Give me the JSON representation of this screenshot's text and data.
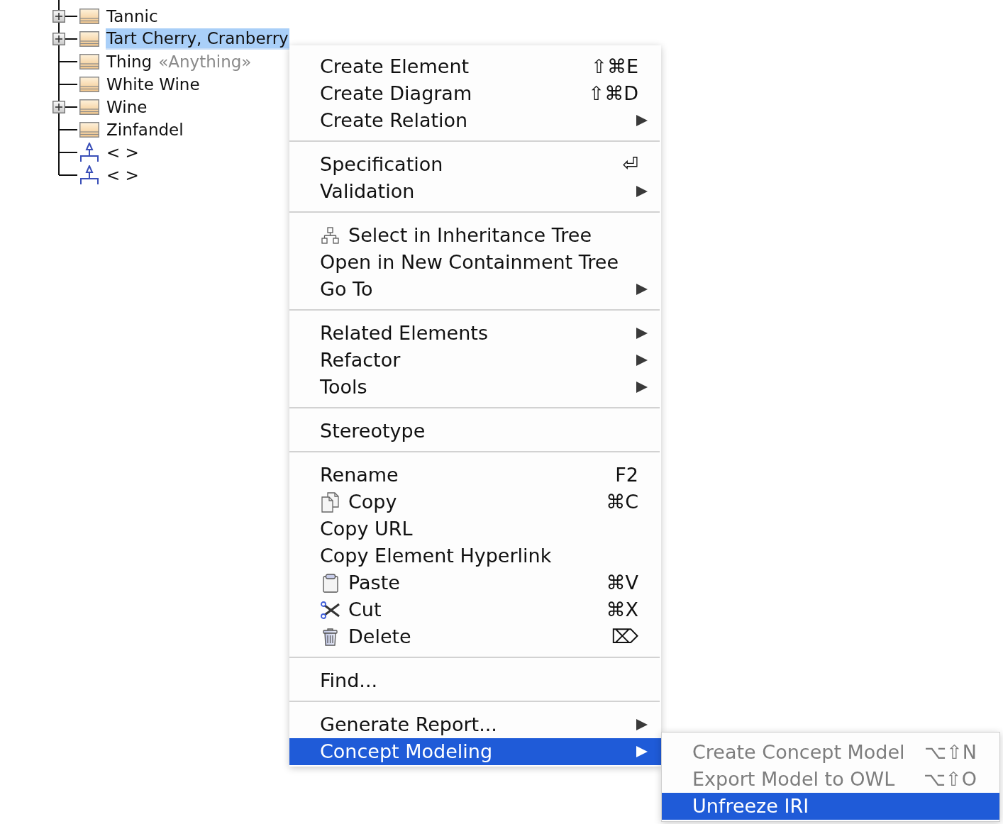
{
  "tree": {
    "items": [
      {
        "label": "Tannic",
        "kind": "class",
        "expandable": true,
        "selected": false
      },
      {
        "label": "Tart Cherry, Cranberry",
        "kind": "class",
        "expandable": true,
        "selected": true
      },
      {
        "label": "Thing",
        "stereotype": "«Anything»",
        "kind": "class",
        "expandable": false,
        "selected": false
      },
      {
        "label": "White Wine",
        "kind": "class",
        "expandable": false,
        "selected": false
      },
      {
        "label": "Wine",
        "kind": "class",
        "expandable": true,
        "selected": false
      },
      {
        "label": "Zinfandel",
        "kind": "class",
        "expandable": false,
        "selected": false
      },
      {
        "label": "< >",
        "kind": "generalization",
        "expandable": false,
        "selected": false
      },
      {
        "label": "< >",
        "kind": "generalization",
        "expandable": false,
        "selected": false
      }
    ]
  },
  "context_menu": {
    "groups": [
      {
        "items": [
          {
            "label": "Create Element",
            "kind": "command",
            "shortcut": "⇧⌘E",
            "submenu": false,
            "selected": false
          },
          {
            "label": "Create Diagram",
            "kind": "command",
            "shortcut": "⇧⌘D",
            "submenu": false,
            "selected": false
          },
          {
            "label": "Create Relation",
            "kind": "command",
            "submenu": true,
            "selected": false
          }
        ]
      },
      {
        "items": [
          {
            "label": "Specification",
            "kind": "command",
            "shortcut": "⏎",
            "submenu": false,
            "selected": false
          },
          {
            "label": "Validation",
            "kind": "command",
            "submenu": true,
            "selected": false
          }
        ]
      },
      {
        "items": [
          {
            "label": "Select in Inheritance Tree",
            "kind": "hierarchy",
            "submenu": false,
            "selected": false
          },
          {
            "label": "Open in New Containment Tree",
            "kind": "command",
            "submenu": false,
            "selected": false
          },
          {
            "label": "Go To",
            "kind": "command",
            "submenu": true,
            "selected": false
          }
        ]
      },
      {
        "items": [
          {
            "label": "Related Elements",
            "kind": "command",
            "submenu": true,
            "selected": false
          },
          {
            "label": "Refactor",
            "kind": "command",
            "submenu": true,
            "selected": false
          },
          {
            "label": "Tools",
            "kind": "command",
            "submenu": true,
            "selected": false
          }
        ]
      },
      {
        "items": [
          {
            "label": "Stereotype",
            "kind": "command",
            "submenu": false,
            "selected": false
          }
        ]
      },
      {
        "items": [
          {
            "label": "Rename",
            "kind": "command",
            "shortcut": "F2",
            "submenu": false,
            "selected": false
          },
          {
            "label": "Copy",
            "kind": "copy",
            "shortcut": "⌘C",
            "submenu": false,
            "selected": false
          },
          {
            "label": "Copy URL",
            "kind": "command",
            "submenu": false,
            "selected": false
          },
          {
            "label": "Copy Element Hyperlink",
            "kind": "command",
            "submenu": false,
            "selected": false
          },
          {
            "label": "Paste",
            "kind": "paste",
            "shortcut": "⌘V",
            "submenu": false,
            "selected": false
          },
          {
            "label": "Cut",
            "kind": "cut",
            "shortcut": "⌘X",
            "submenu": false,
            "selected": false
          },
          {
            "label": "Delete",
            "kind": "delete",
            "shortcut": "⌦",
            "submenu": false,
            "selected": false
          }
        ]
      },
      {
        "items": [
          {
            "label": "Find...",
            "kind": "command",
            "submenu": false,
            "selected": false
          }
        ]
      },
      {
        "items": [
          {
            "label": "Generate Report...",
            "kind": "command",
            "submenu": true,
            "selected": false
          },
          {
            "label": "Concept Modeling",
            "kind": "command",
            "submenu": true,
            "selected": true
          }
        ]
      }
    ]
  },
  "submenu": {
    "items": [
      {
        "label": "Create Concept Model",
        "shortcut": "⌥⇧N",
        "disabled": true,
        "selected": false
      },
      {
        "label": "Export Model to OWL",
        "shortcut": "⌥⇧O",
        "disabled": true,
        "selected": false
      },
      {
        "label": "Unfreeze IRI",
        "disabled": false,
        "selected": true
      }
    ]
  }
}
